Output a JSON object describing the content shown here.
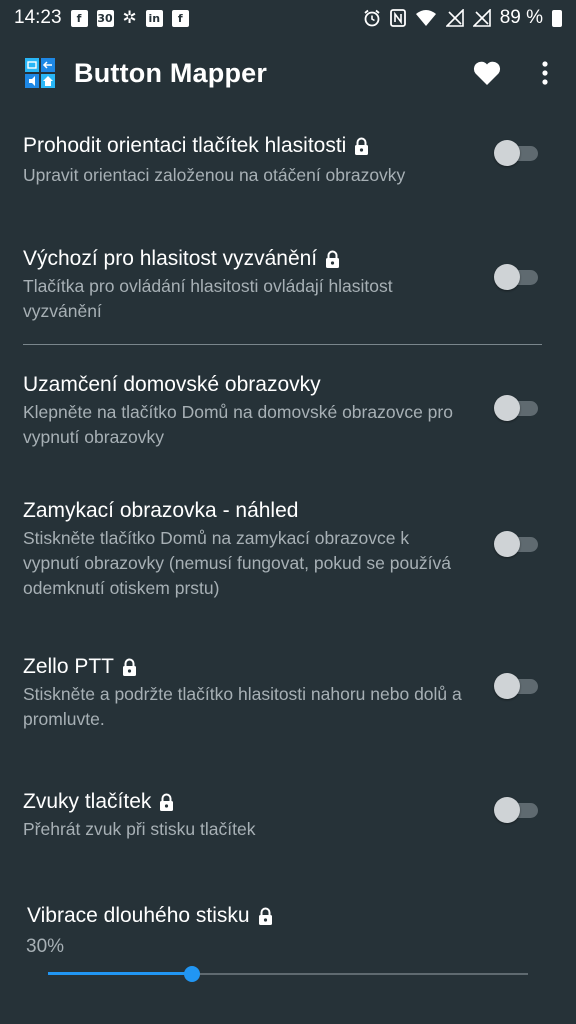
{
  "status_bar": {
    "time": "14:23",
    "battery": "89 %",
    "left_icons": [
      "facebook-icon",
      "calendar-icon",
      "slack-icon",
      "linkedin-icon",
      "facebook-icon"
    ],
    "calendar_day": "30",
    "right_icons": [
      "alarm-icon",
      "nfc-icon",
      "wifi-icon",
      "no-signal-icon",
      "no-signal-icon",
      "battery-icon"
    ]
  },
  "app_bar": {
    "title": "Button Mapper",
    "actions": [
      "heart-icon",
      "more-vert-icon"
    ]
  },
  "settings": [
    {
      "title": "Prohodit orientaci tlačítek hlasitosti",
      "summary": "Upravit orientaci založenou na otáčení obrazovky",
      "locked": true,
      "enabled": false
    },
    {
      "title": "Výchozí pro hlasitost vyzvánění",
      "summary": "Tlačítka pro ovládání hlasitosti ovládají hlasitost vyzvánění",
      "locked": true,
      "enabled": false
    },
    {
      "title": "Uzamčení domovské obrazovky",
      "summary": "Klepněte na tlačítko Domů na domovské obrazovce pro vypnutí obrazovky",
      "locked": false,
      "enabled": false
    },
    {
      "title": "Zamykací obrazovka - náhled",
      "summary": "Stiskněte tlačítko Domů na zamykací obrazovce k vypnutí obrazovky (nemusí fungovat, pokud se používá odemknutí otiskem prstu)",
      "locked": false,
      "enabled": false
    },
    {
      "title": "Zello PTT",
      "summary": "Stiskněte a podržte tlačítko hlasitosti nahoru nebo dolů a promluvte.",
      "locked": true,
      "enabled": false
    },
    {
      "title": "Zvuky tlačítek",
      "summary": "Přehrát zvuk při stisku tlačítek",
      "locked": true,
      "enabled": false
    }
  ],
  "vibration_slider": {
    "title": "Vibrace dlouhého stisku",
    "value_label": "30%",
    "value_fraction": 0.3,
    "locked": true
  },
  "colors": {
    "background": "#263238",
    "accent": "#2196f3",
    "summary_text": "#a7b0b5",
    "toggle_off_thumb": "#cfd3d6",
    "toggle_off_track": "#5f6a70"
  }
}
